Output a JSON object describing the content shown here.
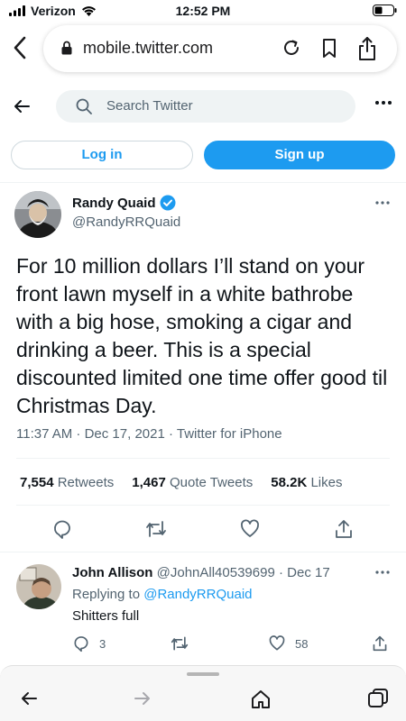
{
  "status_bar": {
    "carrier": "Verizon",
    "time": "12:52 PM"
  },
  "browser": {
    "url": "mobile.twitter.com"
  },
  "twitter_header": {
    "search_placeholder": "Search Twitter"
  },
  "auth": {
    "login_label": "Log in",
    "signup_label": "Sign up"
  },
  "tweet": {
    "author_name": "Randy Quaid",
    "author_handle": "@RandyRRQuaid",
    "text": "For 10 million dollars I’ll stand on your front lawn myself in a white bathrobe with a big hose, smoking a cigar and drinking a beer. This is a special discounted limited one time offer good til Christmas Day.",
    "timestamp": "11:37 AM · Dec 17, 2021 · Twitter for iPhone",
    "retweets_count": "7,554",
    "retweets_label": "Retweets",
    "quote_count": "1,467",
    "quote_label": "Quote Tweets",
    "likes_count": "58.2K",
    "likes_label": "Likes"
  },
  "reply": {
    "author_name": "John Allison",
    "author_handle": "@JohnAll40539699",
    "date": "Dec 17",
    "replying_prefix": "Replying to",
    "replying_handle": "@RandyRRQuaid",
    "text": "Shitters full",
    "reply_count": "3",
    "like_count": "58"
  },
  "colors": {
    "accent": "#1d9bf0",
    "text": "#0f1419",
    "secondary": "#536471"
  },
  "icons": [
    "signal-icon",
    "wifi-icon",
    "battery-icon",
    "back-chevron-icon",
    "lock-icon",
    "reload-icon",
    "bookmark-icon",
    "share-icon",
    "arrow-left-icon",
    "search-icon",
    "more-icon",
    "verified-badge-icon",
    "reply-icon",
    "retweet-icon",
    "like-icon",
    "home-icon",
    "tabs-icon",
    "forward-icon"
  ]
}
